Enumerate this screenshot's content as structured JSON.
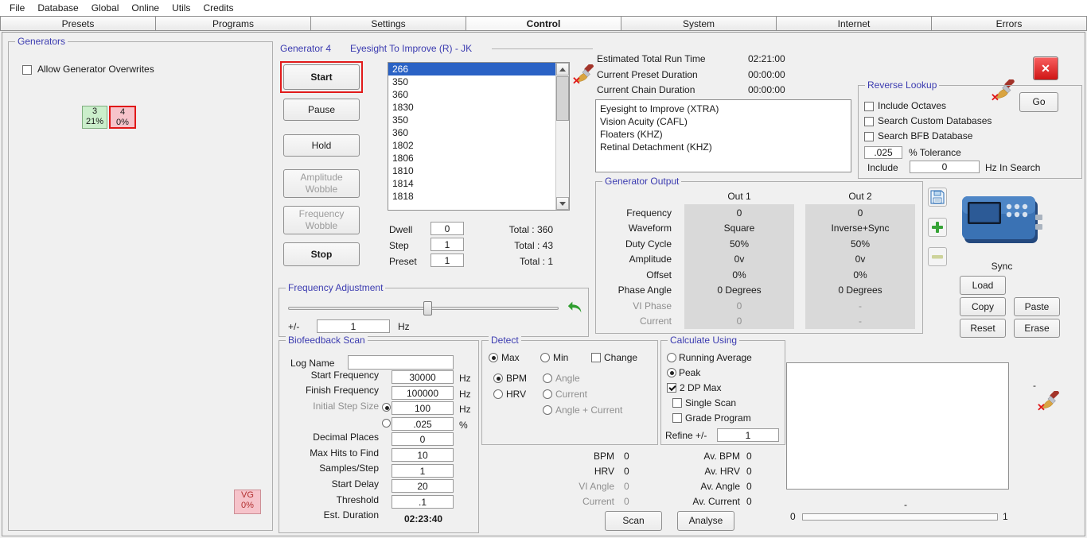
{
  "colors": {
    "accent_label": "#3b3bb0",
    "selection_blue": "#2a62c5",
    "highlight_red": "#e01818",
    "badge_green_bg": "#cbeecb",
    "badge_pink_bg": "#f6c3ca"
  },
  "menubar": {
    "items": [
      "File",
      "Database",
      "Global",
      "Online",
      "Utils",
      "Credits"
    ]
  },
  "tabs": {
    "items": [
      "Presets",
      "Programs",
      "Settings",
      "Control",
      "System",
      "Internet",
      "Errors"
    ],
    "active": "Control"
  },
  "generators": {
    "title": "Generators",
    "allow_overwrites": "Allow Generator Overwrites",
    "gen3": {
      "num": "3",
      "pct": "21%"
    },
    "gen4": {
      "num": "4",
      "pct": "0%"
    },
    "vg": {
      "num": "VG",
      "pct": "0%"
    }
  },
  "generator": {
    "title": "Generator 4",
    "loaded_preset": "Eyesight To Improve (R) - JK",
    "start": "Start",
    "pause": "Pause",
    "hold": "Hold",
    "amplitude_wobble": "Amplitude Wobble",
    "frequency_wobble": "Frequency Wobble",
    "stop": "Stop",
    "frequencies": [
      "266",
      "350",
      "360",
      "1830",
      "350",
      "360",
      "1802",
      "1806",
      "1810",
      "1814",
      "1818"
    ],
    "selected_frequency": "266",
    "dwell_label": "Dwell",
    "dwell": "0",
    "step_label": "Step",
    "step": "1",
    "preset_label": "Preset",
    "preset": "1",
    "total_frequencies": "Total : 360",
    "total_programs": "Total : 43",
    "total_presets": "Total : 1"
  },
  "run_info": {
    "estimated_label": "Estimated Total Run Time",
    "estimated": "02:21:00",
    "preset_label": "Current Preset Duration",
    "preset": "00:00:00",
    "chain_label": "Current Chain Duration",
    "chain": "00:00:00",
    "programs": [
      "Eyesight to Improve (XTRA)",
      "Vision Acuity (CAFL)",
      "Floaters (KHZ)",
      "Retinal Detachment (KHZ)"
    ]
  },
  "reverse_lookup": {
    "title": "Reverse Lookup",
    "go": "Go",
    "include_octaves": "Include Octaves",
    "search_custom": "Search Custom Databases",
    "search_bfb": "Search BFB Database",
    "tolerance": ".025",
    "tolerance_label": "% Tolerance",
    "include_label": "Include",
    "include_hz": "0",
    "include_suffix": "Hz In Search"
  },
  "output": {
    "title": "Generator Output",
    "out1_header": "Out 1",
    "out2_header": "Out 2",
    "rows": [
      {
        "label": "Frequency",
        "out1": "0",
        "out2": "0"
      },
      {
        "label": "Waveform",
        "out1": "Square",
        "out2": "Inverse+Sync"
      },
      {
        "label": "Duty Cycle",
        "out1": "50%",
        "out2": "50%"
      },
      {
        "label": "Amplitude",
        "out1": "0v",
        "out2": "0v"
      },
      {
        "label": "Offset",
        "out1": "0%",
        "out2": "0%"
      },
      {
        "label": "Phase Angle",
        "out1": "0 Degrees",
        "out2": "0 Degrees"
      },
      {
        "label": "VI Phase",
        "out1": "0",
        "out2": "-"
      },
      {
        "label": "Current",
        "out1": "0",
        "out2": "-"
      }
    ],
    "sync": "Sync",
    "load": "Load",
    "copy": "Copy",
    "paste": "Paste",
    "reset": "Reset",
    "erase": "Erase"
  },
  "freq_adjust": {
    "title": "Frequency Adjustment",
    "plusminus": "+/-",
    "amount": "1",
    "unit": "Hz"
  },
  "biofeedback": {
    "title": "Biofeedback Scan",
    "log_name_label": "Log Name",
    "log_name": "",
    "rows": [
      {
        "label": "Start Frequency",
        "value": "30000",
        "unit": "Hz"
      },
      {
        "label": "Finish Frequency",
        "value": "100000",
        "unit": "Hz"
      },
      {
        "label": "Initial Step Size",
        "value": "100",
        "unit": "Hz"
      },
      {
        "label": "",
        "value": ".025",
        "unit": "%"
      },
      {
        "label": "Decimal Places",
        "value": "0",
        "unit": ""
      },
      {
        "label": "Max Hits to Find",
        "value": "10",
        "unit": ""
      },
      {
        "label": "Samples/Step",
        "value": "1",
        "unit": ""
      },
      {
        "label": "Start Delay",
        "value": "20",
        "unit": ""
      },
      {
        "label": "Threshold",
        "value": ".1",
        "unit": ""
      },
      {
        "label": "Est. Duration",
        "value": "02:23:40",
        "unit": ""
      }
    ]
  },
  "detect": {
    "title": "Detect",
    "max": "Max",
    "min": "Min",
    "change": "Change",
    "bpm": "BPM",
    "hrv": "HRV",
    "angle": "Angle",
    "current": "Current",
    "angle_current": "Angle + Current"
  },
  "calc": {
    "title": "Calculate Using",
    "running_avg": "Running Average",
    "peak": "Peak",
    "dp_max": "2 DP Max",
    "single_scan": "Single Scan",
    "grade_program": "Grade Program",
    "refine_label": "Refine +/-",
    "refine": "1"
  },
  "readings": {
    "bpm_label": "BPM",
    "bpm": "0",
    "av_bpm_label": "Av. BPM",
    "av_bpm": "0",
    "hrv_label": "HRV",
    "hrv": "0",
    "av_hrv_label": "Av. HRV",
    "av_hrv": "0",
    "vi_angle_label": "VI Angle",
    "vi_angle": "0",
    "av_angle_label": "Av. Angle",
    "av_angle": "0",
    "current_label": "Current",
    "current": "0",
    "av_current_label": "Av. Current",
    "av_current": "0",
    "scan": "Scan",
    "analyse": "Analyse"
  },
  "graph": {
    "right_marker": "-",
    "bottom_marker": "-",
    "range_min": "0",
    "range_max": "1"
  }
}
